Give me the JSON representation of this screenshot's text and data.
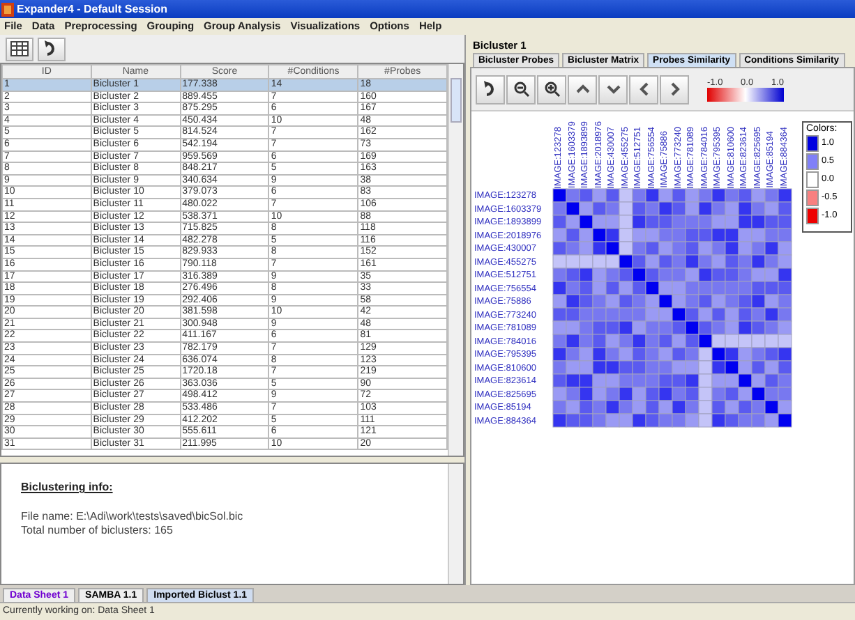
{
  "window": {
    "title": "Expander4 - Default Session"
  },
  "menu": [
    "File",
    "Data",
    "Preprocessing",
    "Grouping",
    "Group Analysis",
    "Visualizations",
    "Options",
    "Help"
  ],
  "table": {
    "columns": [
      "ID",
      "Name",
      "Score",
      "#Conditions",
      "#Probes"
    ],
    "rows": [
      {
        "cells": [
          "1",
          "Bicluster 1",
          "177.338",
          "14",
          "18"
        ],
        "selected": true
      },
      {
        "cells": [
          "2",
          "Bicluster 2",
          "889.455",
          "7",
          "160"
        ],
        "selected": false
      },
      {
        "cells": [
          "3",
          "Bicluster 3",
          "875.295",
          "6",
          "167"
        ],
        "selected": false
      },
      {
        "cells": [
          "4",
          "Bicluster 4",
          "450.434",
          "10",
          "48"
        ],
        "selected": false
      },
      {
        "cells": [
          "5",
          "Bicluster 5",
          "814.524",
          "7",
          "162"
        ],
        "selected": false
      },
      {
        "cells": [
          "6",
          "Bicluster 6",
          "542.194",
          "7",
          "73"
        ],
        "selected": false
      },
      {
        "cells": [
          "7",
          "Bicluster 7",
          "959.569",
          "6",
          "169"
        ],
        "selected": false
      },
      {
        "cells": [
          "8",
          "Bicluster 8",
          "848.217",
          "5",
          "163"
        ],
        "selected": false
      },
      {
        "cells": [
          "9",
          "Bicluster 9",
          "340.634",
          "9",
          "38"
        ],
        "selected": false
      },
      {
        "cells": [
          "10",
          "Bicluster 10",
          "379.073",
          "6",
          "83"
        ],
        "selected": false
      },
      {
        "cells": [
          "11",
          "Bicluster 11",
          "480.022",
          "7",
          "106"
        ],
        "selected": false
      },
      {
        "cells": [
          "12",
          "Bicluster 12",
          "538.371",
          "10",
          "88"
        ],
        "selected": false
      },
      {
        "cells": [
          "13",
          "Bicluster 13",
          "715.825",
          "8",
          "118"
        ],
        "selected": false
      },
      {
        "cells": [
          "14",
          "Bicluster 14",
          "482.278",
          "5",
          "116"
        ],
        "selected": false
      },
      {
        "cells": [
          "15",
          "Bicluster 15",
          "829.933",
          "8",
          "152"
        ],
        "selected": false
      },
      {
        "cells": [
          "16",
          "Bicluster 16",
          "790.118",
          "7",
          "161"
        ],
        "selected": false
      },
      {
        "cells": [
          "17",
          "Bicluster 17",
          "316.389",
          "9",
          "35"
        ],
        "selected": false
      },
      {
        "cells": [
          "18",
          "Bicluster 18",
          "276.496",
          "8",
          "33"
        ],
        "selected": false
      },
      {
        "cells": [
          "19",
          "Bicluster 19",
          "292.406",
          "9",
          "58"
        ],
        "selected": false
      },
      {
        "cells": [
          "20",
          "Bicluster 20",
          "381.598",
          "10",
          "42"
        ],
        "selected": false
      },
      {
        "cells": [
          "21",
          "Bicluster 21",
          "300.948",
          "9",
          "48"
        ],
        "selected": false
      },
      {
        "cells": [
          "22",
          "Bicluster 22",
          "411.167",
          "6",
          "81"
        ],
        "selected": false
      },
      {
        "cells": [
          "23",
          "Bicluster 23",
          "782.179",
          "7",
          "129"
        ],
        "selected": false
      },
      {
        "cells": [
          "24",
          "Bicluster 24",
          "636.074",
          "8",
          "123"
        ],
        "selected": false
      },
      {
        "cells": [
          "25",
          "Bicluster 25",
          "1720.18",
          "7",
          "219"
        ],
        "selected": false
      },
      {
        "cells": [
          "26",
          "Bicluster 26",
          "363.036",
          "5",
          "90"
        ],
        "selected": false
      },
      {
        "cells": [
          "27",
          "Bicluster 27",
          "498.412",
          "9",
          "72"
        ],
        "selected": false
      },
      {
        "cells": [
          "28",
          "Bicluster 28",
          "533.486",
          "7",
          "103"
        ],
        "selected": false
      },
      {
        "cells": [
          "29",
          "Bicluster 29",
          "412.202",
          "5",
          "111"
        ],
        "selected": false
      },
      {
        "cells": [
          "30",
          "Bicluster 30",
          "555.611",
          "6",
          "121"
        ],
        "selected": false
      },
      {
        "cells": [
          "31",
          "Bicluster 31",
          "211.995",
          "10",
          "20"
        ],
        "selected": false
      }
    ]
  },
  "info": {
    "heading": "Biclustering info:",
    "lines": [
      "File name:  E:\\Adi\\work\\tests\\saved\\bicSol.bic",
      "Total number of biclusters:  165"
    ]
  },
  "sheet_tabs": [
    {
      "label": "Data Sheet 1",
      "selected": false,
      "color": "#7000d0"
    },
    {
      "label": "SAMBA 1.1",
      "selected": false,
      "color": "#000000"
    },
    {
      "label": "Imported Biclust 1.1",
      "selected": true,
      "color": "#000000"
    }
  ],
  "status_bar": "Currently working on: Data Sheet 1",
  "detail": {
    "title": "Bicluster 1",
    "tabs": [
      {
        "label": "Bicluster Probes",
        "selected": false
      },
      {
        "label": "Bicluster Matrix",
        "selected": false
      },
      {
        "label": "Probes Similarity",
        "selected": true
      },
      {
        "label": "Conditions Similarity",
        "selected": false
      }
    ],
    "scale_labels": [
      "-1.0",
      "0.0",
      "1.0"
    ],
    "column_labels": [
      "IMAGE:123278",
      "IMAGE:1603379",
      "IMAGE:1893899",
      "IMAGE:2018976",
      "IMAGE:430007",
      "IMAGE:455275",
      "IMAGE:512751",
      "IMAGE:756554",
      "IMAGE:75886",
      "IMAGE:773240",
      "IMAGE:781089",
      "IMAGE:784016",
      "IMAGE:795395",
      "IMAGE:810600",
      "IMAGE:823614",
      "IMAGE:825695",
      "IMAGE:85194",
      "IMAGE:884364"
    ],
    "row_labels": [
      "IMAGE:123278",
      "IMAGE:1603379",
      "IMAGE:1893899",
      "IMAGE:2018976",
      "IMAGE:430007",
      "IMAGE:455275",
      "IMAGE:512751",
      "IMAGE:756554",
      "IMAGE:75886",
      "IMAGE:773240",
      "IMAGE:781089",
      "IMAGE:784016",
      "IMAGE:795395",
      "IMAGE:810600",
      "IMAGE:823614",
      "IMAGE:825695",
      "IMAGE:85194",
      "IMAGE:884364"
    ],
    "legend": {
      "title": "Colors:",
      "labels": [
        "1.0",
        "0.5",
        "0.0",
        "-0.5",
        "-1.0"
      ]
    }
  }
}
